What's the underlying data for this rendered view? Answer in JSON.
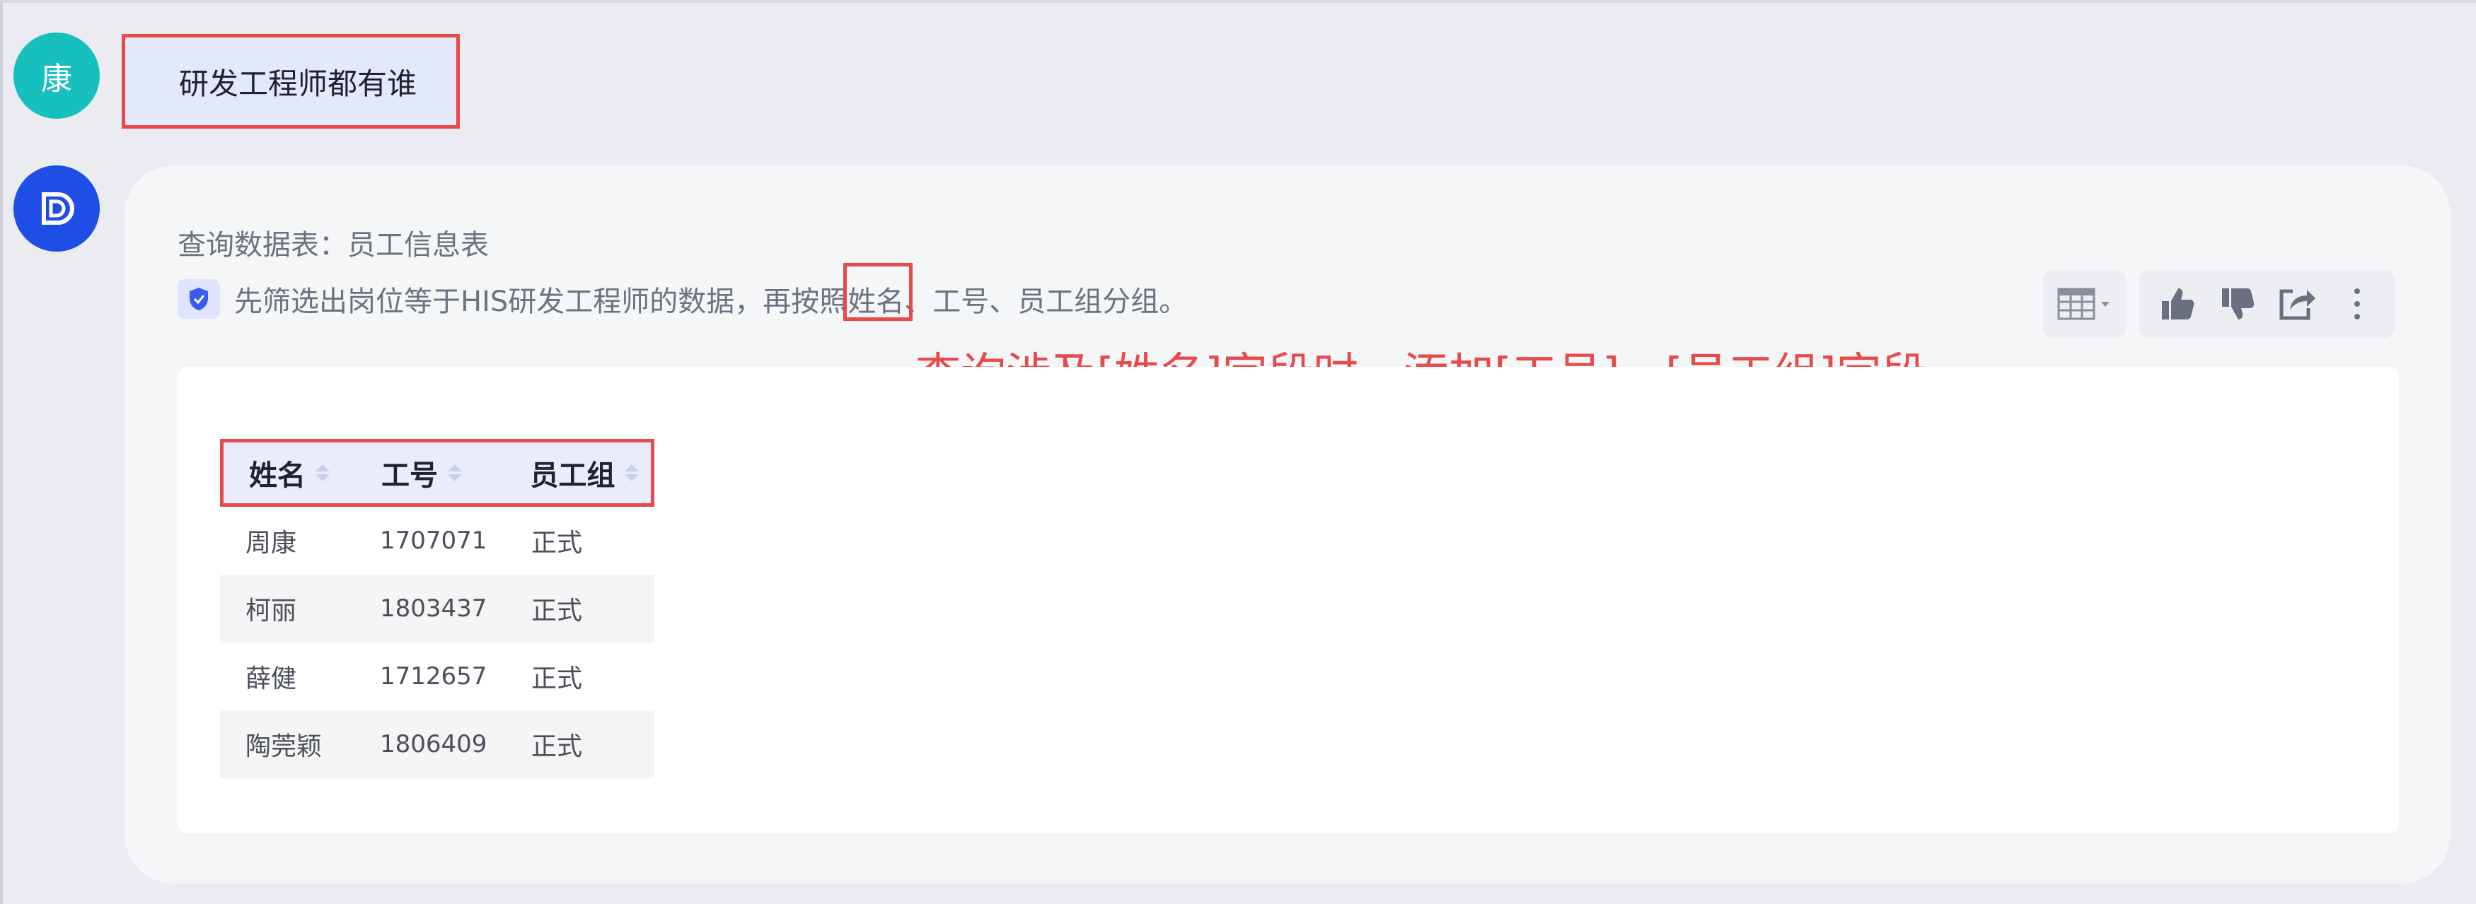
{
  "user": {
    "avatar_text": "康",
    "message": "研发工程师都有谁"
  },
  "answer": {
    "query_table": "查询数据表：员工信息表",
    "description_before": "先筛选出岗位等于HIS研发工程师的数据，再按照",
    "description_highlight": "姓名",
    "description_after": "、工号、员工组分组。",
    "annotation": "查询涉及[姓名]字段时，添加[工号]、[员工组]字段",
    "table": {
      "columns": [
        "姓名",
        "工号",
        "员工组"
      ],
      "rows": [
        [
          "周康",
          "1707071",
          "正式"
        ],
        [
          "柯丽",
          "1803437",
          "正式"
        ],
        [
          "薛健",
          "1712657",
          "正式"
        ],
        [
          "陶莞颖",
          "1806409",
          "正式"
        ]
      ]
    },
    "toolbar": {
      "icons": [
        "table-view-icon",
        "thumbs-up-icon",
        "thumbs-down-icon",
        "share-icon",
        "more-icon"
      ]
    }
  },
  "colors": {
    "highlight_red": "#e84a4a",
    "user_avatar": "#18c0bd",
    "bot_avatar": "#1f4ee6",
    "user_bubble": "#e3e8fb"
  }
}
